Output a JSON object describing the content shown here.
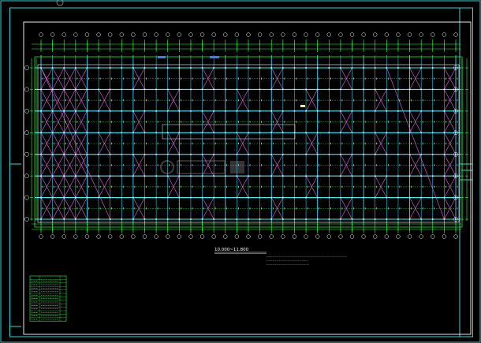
{
  "drawing": {
    "title": "10.000~11.800",
    "title_suffix": "",
    "axis_count_horizontal": 37,
    "axis_count_vertical": 8,
    "notes": [
      "",
      "",
      ""
    ],
    "colors": {
      "background": "#000000",
      "frame": "#3ad1cf",
      "grid_blue": "#3ad7ff",
      "cyan": "#35f0ff",
      "green": "#2cff3a",
      "bracing": "#ff66ff",
      "white": "#ffffff",
      "yellow": "#ffff40"
    },
    "icons": {
      "axis_bubble": "circle-axis-bubble-icon",
      "member_mark": "short-tick-member-icon",
      "corner_logo": "watermark-logo-icon"
    }
  },
  "legend_table": {
    "header": [
      "",
      ""
    ],
    "rows": [
      [
        "",
        ""
      ],
      [
        "",
        ""
      ],
      [
        "",
        ""
      ],
      [
        "",
        ""
      ],
      [
        "",
        ""
      ],
      [
        "",
        ""
      ],
      [
        "",
        ""
      ],
      [
        "",
        ""
      ],
      [
        "",
        ""
      ],
      [
        "",
        ""
      ],
      [
        "",
        ""
      ],
      [
        "",
        ""
      ]
    ]
  }
}
